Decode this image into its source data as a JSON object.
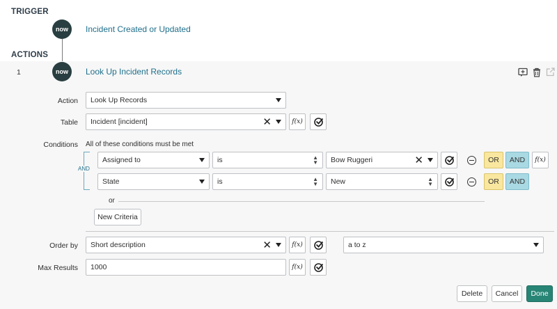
{
  "trigger": {
    "section_label": "TRIGGER",
    "badge_text": "now",
    "title": "Incident Created or Updated"
  },
  "actions": {
    "section_label": "ACTIONS",
    "step_number": "1",
    "badge_text": "now",
    "title": "Look Up Incident Records"
  },
  "form": {
    "action_label": "Action",
    "action_value": "Look Up Records",
    "table_label": "Table",
    "table_value": "Incident [incident]",
    "conditions_label": "Conditions",
    "conditions_caption": "All of these conditions must be met",
    "and_connector": "AND",
    "conditions": [
      {
        "field": "Assigned to",
        "operator": "is",
        "value": "Bow Ruggeri",
        "or_label": "OR",
        "and_label": "AND"
      },
      {
        "field": "State",
        "operator": "is",
        "value": "New",
        "or_label": "OR",
        "and_label": "AND"
      }
    ],
    "or_separator": "or",
    "new_criteria_label": "New Criteria",
    "order_by_label": "Order by",
    "order_by_value": "Short description",
    "order_direction_value": "a to z",
    "max_results_label": "Max Results",
    "max_results_value": "1000",
    "fx_label": "f(x)"
  },
  "footer": {
    "delete_label": "Delete",
    "cancel_label": "Cancel",
    "done_label": "Done"
  },
  "colors": {
    "badge": "#293e40",
    "link_title": "#1f6f8b",
    "or_button": "#f9e79f",
    "and_button": "#a9d9e3",
    "done_button": "#278575"
  },
  "icons": [
    "comment-add-icon",
    "trash-icon",
    "open-external-icon",
    "data-pill-picker-icon",
    "minus-circle-icon",
    "close-icon",
    "chevron-down-icon"
  ]
}
